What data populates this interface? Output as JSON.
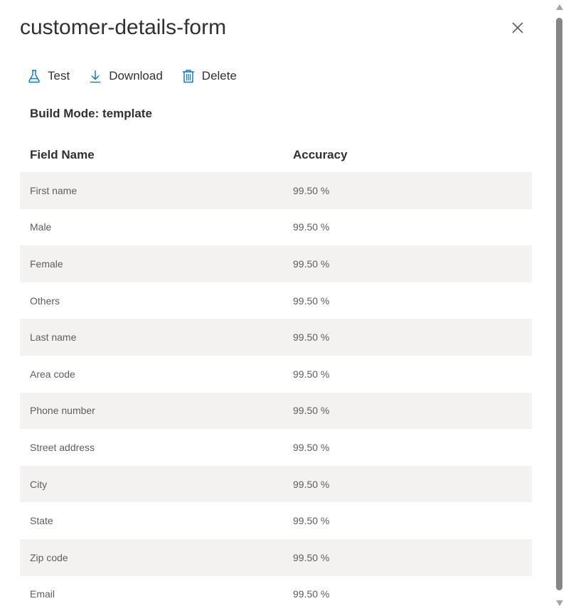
{
  "panel": {
    "title": "customer-details-form",
    "close_icon": "close-icon"
  },
  "toolbar": {
    "items": [
      {
        "label": "Test",
        "icon": "flask-icon"
      },
      {
        "label": "Download",
        "icon": "download-icon"
      },
      {
        "label": "Delete",
        "icon": "trash-icon"
      }
    ]
  },
  "build_mode": "Build Mode: template",
  "table": {
    "headers": [
      "Field Name",
      "Accuracy"
    ],
    "rows": [
      {
        "field": "First name",
        "accuracy": "99.50 %"
      },
      {
        "field": "Male",
        "accuracy": "99.50 %"
      },
      {
        "field": "Female",
        "accuracy": "99.50 %"
      },
      {
        "field": "Others",
        "accuracy": "99.50 %"
      },
      {
        "field": "Last name",
        "accuracy": "99.50 %"
      },
      {
        "field": "Area code",
        "accuracy": "99.50 %"
      },
      {
        "field": "Phone number",
        "accuracy": "99.50 %"
      },
      {
        "field": "Street address",
        "accuracy": "99.50 %"
      },
      {
        "field": "City",
        "accuracy": "99.50 %"
      },
      {
        "field": "State",
        "accuracy": "99.50 %"
      },
      {
        "field": "Zip code",
        "accuracy": "99.50 %"
      },
      {
        "field": "Email",
        "accuracy": "99.50 %"
      }
    ]
  },
  "colors": {
    "accent": "#0078d4",
    "text": "#323130",
    "row_shade": "#f3f2f1"
  }
}
